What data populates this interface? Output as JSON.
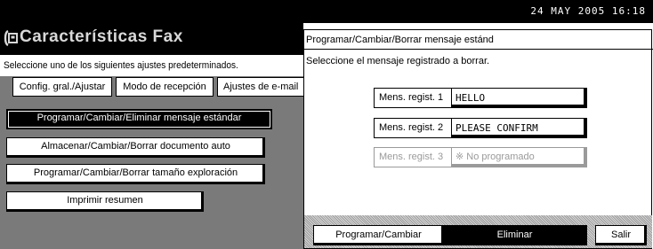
{
  "header": {
    "datetime": "24 MAY  2005 16:18"
  },
  "left_panel": {
    "title": "Características Fax",
    "instruction": "Seleccione uno de los siguientes ajustes predeterminados.",
    "tabs": [
      {
        "label": "Config. gral./Ajustar"
      },
      {
        "label": "Modo de recepción"
      },
      {
        "label": "Ajustes de e-mail"
      }
    ],
    "buttons": [
      {
        "label": "Programar/Cambiar/Eliminar mensaje estándar",
        "selected": true
      },
      {
        "label": "Almacenar/Cambiar/Borrar documento auto"
      },
      {
        "label": "Programar/Cambiar/Borrar tamaño exploración"
      },
      {
        "label": "Imprimir resumen"
      }
    ]
  },
  "dialog": {
    "title": "Programar/Cambiar/Borrar mensaje estánd",
    "instruction": "Seleccione el mensaje registrado a borrar.",
    "messages": [
      {
        "label": "Mens. regist. 1",
        "value": "HELLO"
      },
      {
        "label": "Mens. regist. 2",
        "value": "PLEASE CONFIRM"
      },
      {
        "label": "Mens. regist. 3",
        "value": "※ No programado",
        "disabled": true
      }
    ],
    "buttons": {
      "program": "Programar/Cambiar",
      "delete": "Eliminar",
      "exit": "Salir"
    }
  },
  "icons": {
    "title_icon": "fax-handset-icon"
  }
}
